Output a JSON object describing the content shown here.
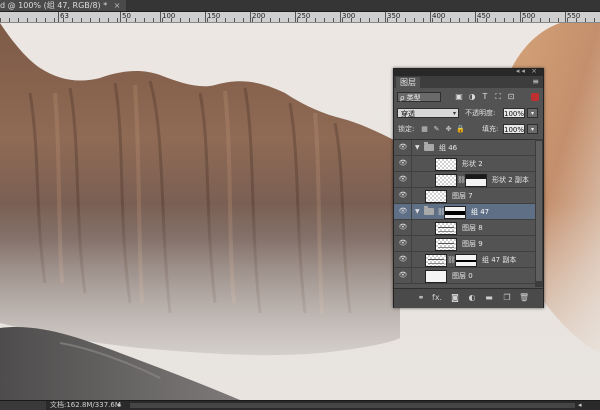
{
  "document": {
    "tab_title": "d @ 100% (组 47, RGB/8) *",
    "close_glyph": "×"
  },
  "ruler": {
    "labels": [
      "63",
      "0",
      "50",
      "100",
      "150",
      "200",
      "250",
      "300",
      "350",
      "400",
      "450",
      "500",
      "550"
    ]
  },
  "status": {
    "doc_size": "文档:162.8M/337.6M",
    "arrow_glyph": "▸",
    "right_arrow_glyph": "◂"
  },
  "layers_panel": {
    "tab_label": "图层",
    "dock_glyph": "◂◂ ×",
    "menu_glyph": "≡",
    "filter": {
      "kind_value": "ρ 类型",
      "icons": [
        "image-filter-icon",
        "adjustment-filter-icon",
        "type-filter-icon",
        "shape-filter-icon",
        "smart-object-filter-icon"
      ]
    },
    "blend_mode": "穿透",
    "opacity_label": "不透明度:",
    "opacity_value": "100%",
    "lock_label": "锁定:",
    "fill_label": "填充:",
    "fill_value": "100%",
    "layers": [
      {
        "name": "组 46",
        "kind": "group",
        "expanded": true,
        "selected": false,
        "indent": 0
      },
      {
        "name": "形状 2",
        "kind": "checker",
        "selected": false,
        "indent": 1
      },
      {
        "name": "形状 2 副本",
        "kind": "checker-mask",
        "selected": false,
        "indent": 1
      },
      {
        "name": "图层 7",
        "kind": "checker",
        "selected": false,
        "indent": 0
      },
      {
        "name": "组 47",
        "kind": "group-mask",
        "expanded": true,
        "selected": true,
        "indent": 0
      },
      {
        "name": "图层 8",
        "kind": "stroke",
        "selected": false,
        "indent": 1
      },
      {
        "name": "图层 9",
        "kind": "stroke",
        "selected": false,
        "indent": 1
      },
      {
        "name": "组 47 副本",
        "kind": "stroke-mask",
        "selected": false,
        "indent": 0
      },
      {
        "name": "图层 0",
        "kind": "white",
        "selected": false,
        "indent": 0
      }
    ],
    "footer_icons": [
      {
        "name": "link-layers-icon",
        "glyph": "⚭"
      },
      {
        "name": "fx-icon",
        "glyph": "fx."
      },
      {
        "name": "add-mask-icon",
        "glyph": "◙"
      },
      {
        "name": "adjustment-layer-icon",
        "glyph": "◐"
      },
      {
        "name": "new-group-icon",
        "glyph": "▬"
      },
      {
        "name": "new-layer-icon",
        "glyph": "❐"
      },
      {
        "name": "delete-layer-icon",
        "glyph": "🗑"
      }
    ]
  }
}
